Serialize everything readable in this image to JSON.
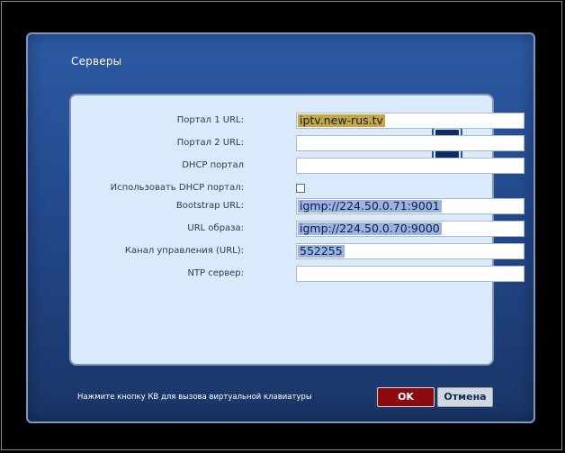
{
  "dialog": {
    "title": "Серверы",
    "icon": "server-icon",
    "hint": "Нажмите кнопку КВ для вызова виртуальной клавиатуры"
  },
  "fields": {
    "portal1": {
      "label": "Портал 1 URL:",
      "value": "iptv.new-rus.tv"
    },
    "portal2": {
      "label": "Портал 2 URL:",
      "value": ""
    },
    "dhcp_portal": {
      "label": "DHCP портал",
      "value": ""
    },
    "use_dhcp": {
      "label": "Использовать DHCP портал:",
      "checked": false
    },
    "bootstrap": {
      "label": "Bootstrap URL:",
      "value": "igmp://224.50.0.71:9001"
    },
    "image_url": {
      "label": "URL образа:",
      "value": "igmp://224.50.0.70:9000"
    },
    "control_channel": {
      "label": "Канал управления (URL):",
      "value": "552255"
    },
    "ntp": {
      "label": "NTP сервер:",
      "value": ""
    }
  },
  "buttons": {
    "ok_label": "OK",
    "cancel_label": "Отмена"
  },
  "colors": {
    "accent_ok": "#8c0a0e",
    "highlight_focus": "#c8a83c",
    "highlight_selection": "#9bb3e3",
    "dialog_bg": "#23498c"
  }
}
